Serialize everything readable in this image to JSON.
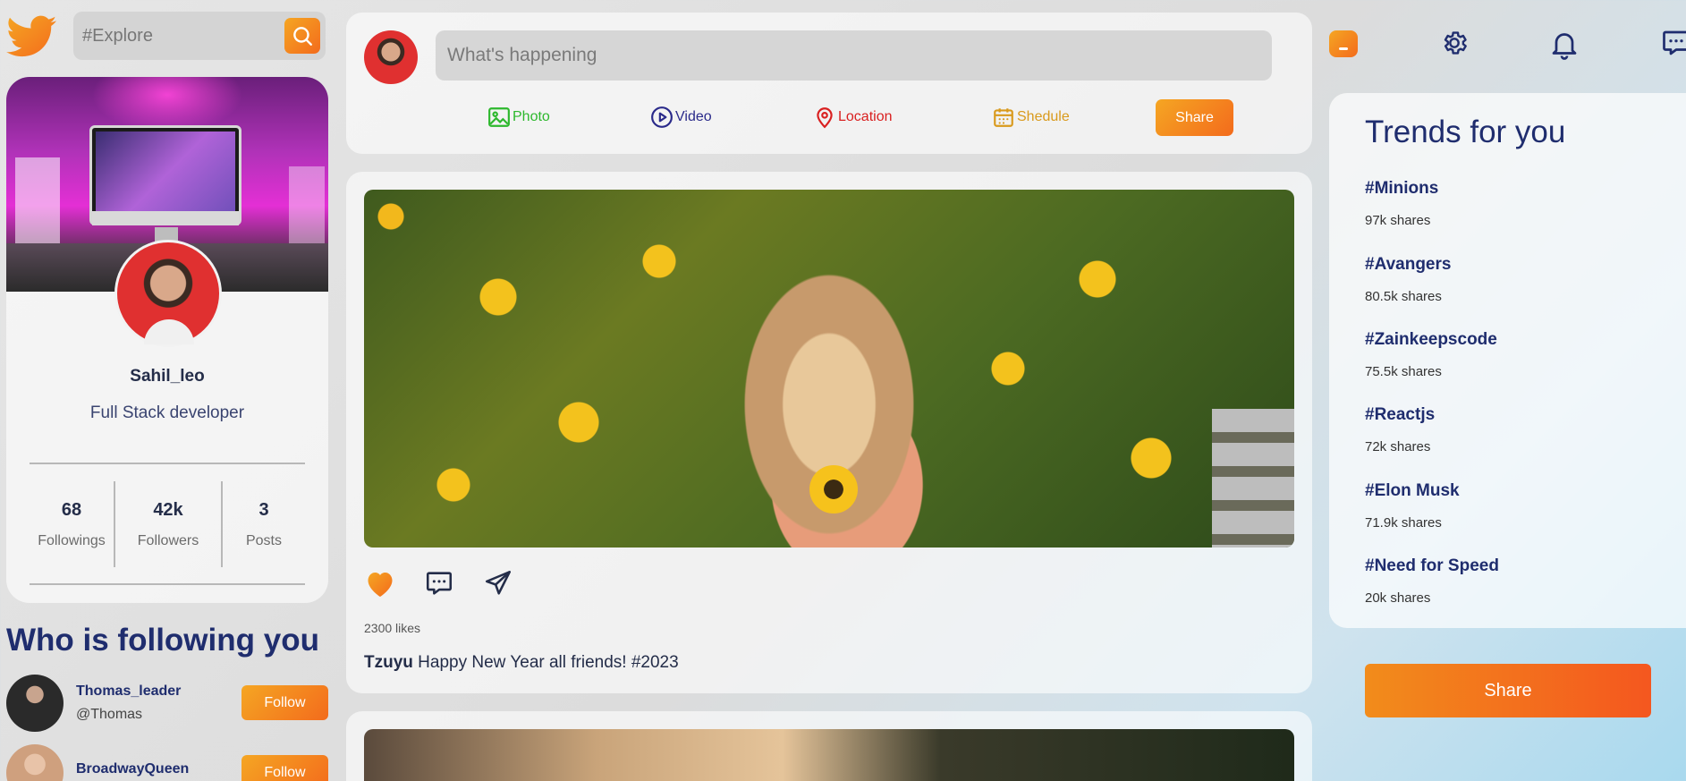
{
  "search": {
    "placeholder": "#Explore"
  },
  "profile": {
    "name": "Sahil_leo",
    "role": "Full Stack developer",
    "stats": [
      {
        "value": "68",
        "label": "Followings"
      },
      {
        "value": "42k",
        "label": "Followers"
      },
      {
        "value": "3",
        "label": "Posts"
      }
    ]
  },
  "who_following": {
    "title": "Who is following you",
    "items": [
      {
        "username": "Thomas_leader",
        "handle": "@Thomas",
        "button": "Follow"
      },
      {
        "username": "BroadwayQueen",
        "handle": "",
        "button": "Follow"
      }
    ]
  },
  "composer": {
    "placeholder": "What's happening",
    "options": [
      {
        "label": "Photo",
        "color": "#2db82d"
      },
      {
        "label": "Video",
        "color": "#2a2a8a"
      },
      {
        "label": "Location",
        "color": "#d92020"
      },
      {
        "label": "Shedule",
        "color": "#d99a1c"
      }
    ],
    "share_label": "Share"
  },
  "post": {
    "likes": "2300 likes",
    "author": "Tzuyu",
    "text": "Happy New Year all friends! #2023"
  },
  "nav": {
    "icons": [
      "home-icon",
      "gear-icon",
      "bell-icon",
      "chat-icon"
    ]
  },
  "trends": {
    "title": "Trends for you",
    "items": [
      {
        "tag": "#Minions",
        "shares": "97k shares"
      },
      {
        "tag": "#Avangers",
        "shares": "80.5k shares"
      },
      {
        "tag": "#Zainkeepscode",
        "shares": "75.5k shares"
      },
      {
        "tag": "#Reactjs",
        "shares": "72k shares"
      },
      {
        "tag": "#Elon Musk",
        "shares": "71.9k shares"
      },
      {
        "tag": "#Need for Speed",
        "shares": "20k shares"
      }
    ],
    "share_label": "Share"
  },
  "colors": {
    "accent_start": "#f5a623",
    "accent_end": "#f36b1c",
    "text_primary": "#242d49",
    "heading": "#1f2d6e"
  }
}
